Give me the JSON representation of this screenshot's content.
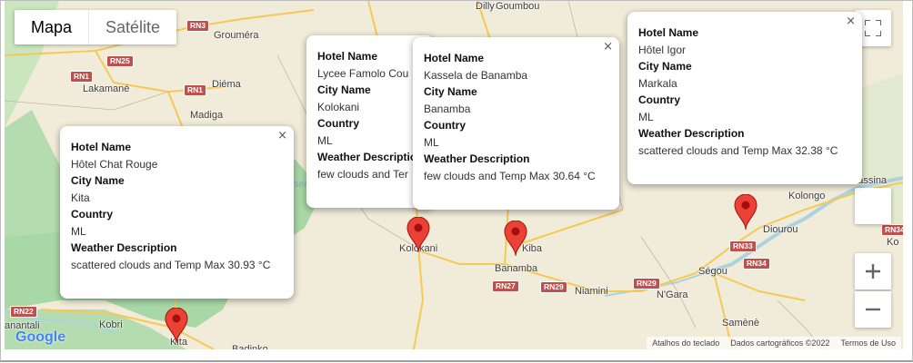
{
  "map_type": {
    "map": "Mapa",
    "satellite": "Satélite"
  },
  "places": [
    {
      "name": "Dilly",
      "key": "dilly"
    },
    {
      "name": "Goumbou",
      "key": "goumbou"
    },
    {
      "name": "Grouméra",
      "key": "groumera"
    },
    {
      "name": "Lakamané",
      "key": "lakamane"
    },
    {
      "name": "Diéma",
      "key": "diema"
    },
    {
      "name": "Madiga",
      "key": "madiga"
    },
    {
      "name": "Kolokani",
      "key": "kolokani"
    },
    {
      "name": "Kiba",
      "key": "kiba"
    },
    {
      "name": "Banamba",
      "key": "banamba"
    },
    {
      "name": "Niamini",
      "key": "niamini"
    },
    {
      "name": "N'Gara",
      "key": "ngara"
    },
    {
      "name": "Ségou",
      "key": "segou"
    },
    {
      "name": "Diourou",
      "key": "diourou"
    },
    {
      "name": "Kolongo",
      "key": "kolongo"
    },
    {
      "name": "Ke-Massina",
      "key": "kemassina"
    },
    {
      "name": "Samènè",
      "key": "samene"
    },
    {
      "name": "Kobri",
      "key": "kobri"
    },
    {
      "name": "anantali",
      "key": "anantali"
    },
    {
      "name": "Kita",
      "key": "kita"
    },
    {
      "name": "Badinko",
      "key": "badinko"
    },
    {
      "name": "Ko",
      "key": "ko"
    }
  ],
  "roads": {
    "rn3": "RN3",
    "rn25": "RN25",
    "rn1a": "RN1",
    "rn1b": "RN1",
    "rn22": "RN22",
    "rn27": "RN27",
    "rn29a": "RN29",
    "rn29b": "RN29",
    "rn33": "RN33",
    "rn34a": "RN34",
    "rn34b": "RN34"
  },
  "water_label": "ser sa",
  "popups": [
    {
      "hotel_label": "Hotel Name",
      "hotel": "Hôtel Chat Rouge",
      "city_label": "City Name",
      "city": "Kita",
      "country_label": "Country",
      "country": "ML",
      "weather_label": "Weather Description",
      "weather": "scattered clouds and Temp Max 30.93 °C"
    },
    {
      "hotel_label": "Hotel Name",
      "hotel": "Lycee Famolo Cou",
      "city_label": "City Name",
      "city": "Kolokani",
      "country_label": "Country",
      "country": "ML",
      "weather_label": "Weather Descriptio",
      "weather": "few clouds and Ter"
    },
    {
      "hotel_label": "Hotel Name",
      "hotel": "Kassela de Banamba",
      "city_label": "City Name",
      "city": "Banamba",
      "country_label": "Country",
      "country": "ML",
      "weather_label": "Weather Description",
      "weather": "few clouds and Temp Max 30.64 °C"
    },
    {
      "hotel_label": "Hotel Name",
      "hotel": "Hôtel Igor",
      "city_label": "City Name",
      "city": "Markala",
      "country_label": "Country",
      "country": "ML",
      "weather_label": "Weather Description",
      "weather": "scattered clouds and Temp Max 32.38 °C"
    }
  ],
  "close_glyph": "×",
  "footer": {
    "shortcuts": "Atalhos do teclado",
    "mapdata": "Dados cartográficos ©2022",
    "terms": "Termos de Uso"
  },
  "logo": "Google",
  "colors": {
    "marker": "#ea4335",
    "marker_dark": "#a50e0e",
    "forest": "#a8d8a6",
    "land": "#f1ebd9",
    "road": "#f5c955",
    "shield": "#c0504d",
    "river": "#aad3df"
  },
  "icons": {
    "fullscreen": "fullscreen-icon",
    "zoom_in": "zoom-in-icon",
    "zoom_out": "zoom-out-icon",
    "marker": "map-marker-icon"
  }
}
